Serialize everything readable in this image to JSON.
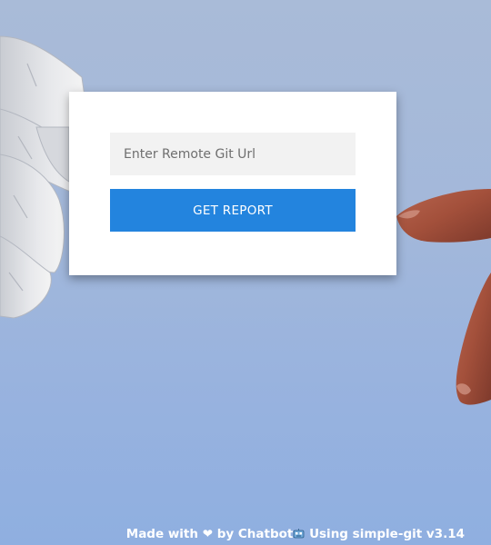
{
  "form": {
    "url_placeholder": "Enter Remote Git Url",
    "url_value": "",
    "submit_label": "GET REPORT"
  },
  "footer": {
    "made_with": "Made with",
    "heart": "❤",
    "by": "by Chatbot",
    "using": "Using simple-git v3.14"
  },
  "icons": {
    "heart": "heart-icon",
    "robot": "robot-icon"
  },
  "colors": {
    "button": "#2384de",
    "input_background": "#f2f2f2",
    "card_background": "#ffffff",
    "footer_text": "#ffffff"
  }
}
